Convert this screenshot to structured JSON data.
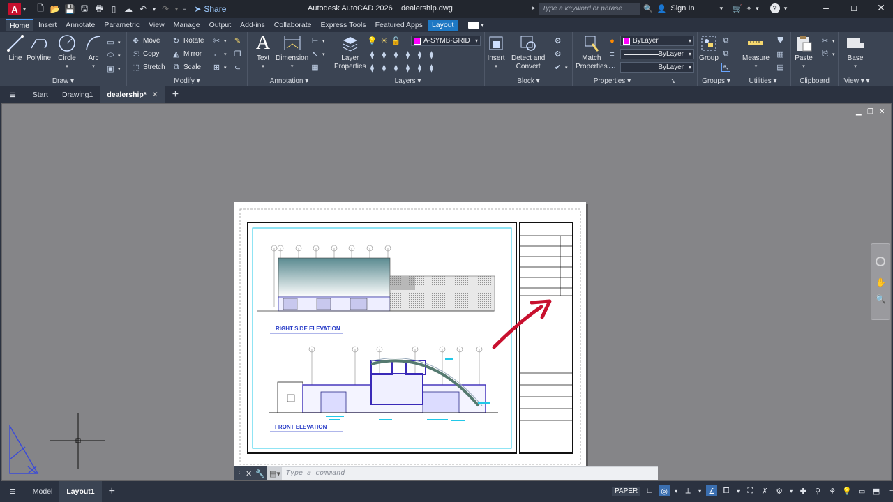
{
  "app": {
    "title": "Autodesk AutoCAD 2026",
    "file": "dealership.dwg",
    "logo_letter": "A"
  },
  "quick_access": {
    "share_label": "Share"
  },
  "search": {
    "placeholder": "Type a keyword or phrase"
  },
  "account": {
    "sign_in": "Sign In"
  },
  "ribbon_tabs": [
    "Home",
    "Insert",
    "Annotate",
    "Parametric",
    "View",
    "Manage",
    "Output",
    "Add-ins",
    "Collaborate",
    "Express Tools",
    "Featured Apps",
    "Layout"
  ],
  "active_tab": "Home",
  "ribbon": {
    "draw": {
      "label": "Draw",
      "line": "Line",
      "polyline": "Polyline",
      "circle": "Circle",
      "arc": "Arc"
    },
    "modify": {
      "label": "Modify",
      "move": "Move",
      "rotate": "Rotate",
      "copy": "Copy",
      "mirror": "Mirror",
      "stretch": "Stretch",
      "scale": "Scale"
    },
    "annotation": {
      "label": "Annotation",
      "text": "Text",
      "dimension": "Dimension"
    },
    "layers": {
      "label": "Layers",
      "layer_properties_1": "Layer",
      "layer_properties_2": "Properties",
      "current_layer": "A-SYMB-GRID"
    },
    "block": {
      "label": "Block",
      "insert": "Insert",
      "detect_1": "Detect and",
      "detect_2": "Convert"
    },
    "properties": {
      "label": "Properties",
      "match_1": "Match",
      "match_2": "Properties",
      "color": "ByLayer",
      "linetype": "ByLayer",
      "lineweight": "ByLayer"
    },
    "groups": {
      "label": "Groups",
      "group": "Group"
    },
    "utilities": {
      "label": "Utilities",
      "measure": "Measure"
    },
    "clipboard": {
      "label": "Clipboard",
      "paste": "Paste"
    },
    "view": {
      "label": "View",
      "base": "Base"
    }
  },
  "doc_tabs": {
    "start": "Start",
    "drawing1": "Drawing1",
    "dealership": "dealership*"
  },
  "drawing": {
    "right_side_elevation": "RIGHT SIDE ELEVATION",
    "front_elevation": "FRONT ELEVATION"
  },
  "command": {
    "placeholder": "Type a command"
  },
  "status": {
    "model": "Model",
    "layout1": "Layout1",
    "paper": "PAPER"
  },
  "colors": {
    "accent": "#1e78c4",
    "app_red": "#c8102e",
    "layer_swatch": "#ff00ff",
    "arrow_red": "#c8102e"
  }
}
